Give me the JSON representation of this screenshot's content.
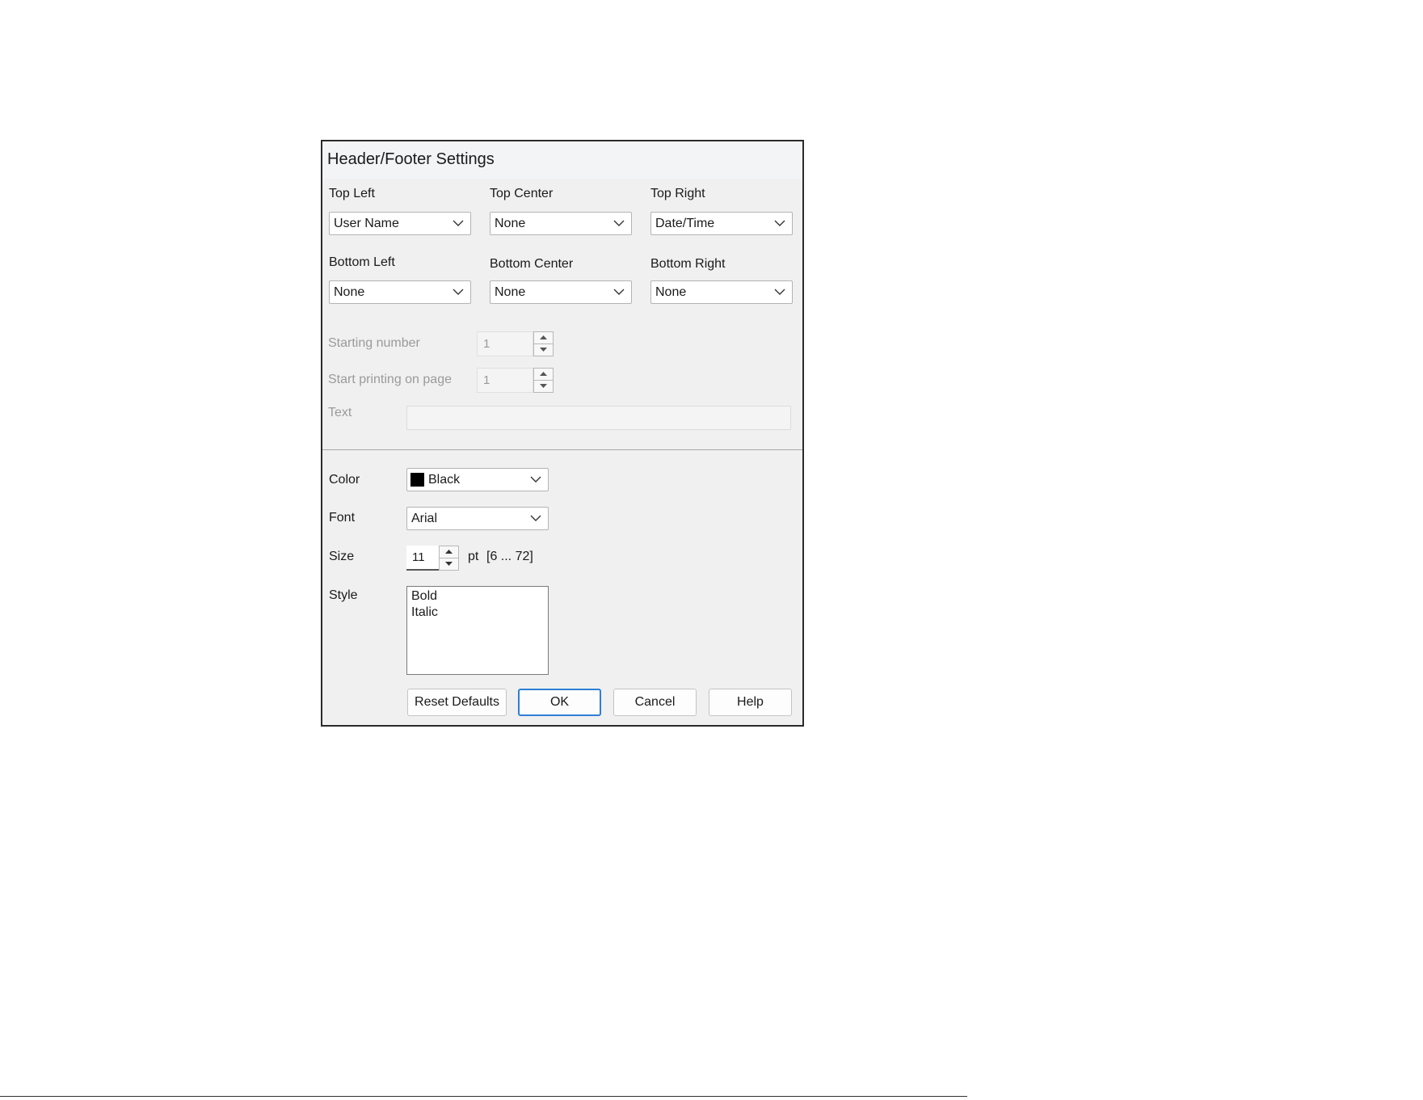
{
  "dialog": {
    "title": "Header/Footer Settings",
    "positions": {
      "top_left": {
        "label": "Top Left",
        "value": "User Name"
      },
      "top_center": {
        "label": "Top Center",
        "value": "None"
      },
      "top_right": {
        "label": "Top Right",
        "value": "Date/Time"
      },
      "bottom_left": {
        "label": "Bottom Left",
        "value": "None"
      },
      "bottom_center": {
        "label": "Bottom Center",
        "value": "None"
      },
      "bottom_right": {
        "label": "Bottom Right",
        "value": "None"
      }
    },
    "starting_number": {
      "label": "Starting number",
      "value": "1"
    },
    "start_printing": {
      "label": "Start printing on page",
      "value": "1"
    },
    "text": {
      "label": "Text",
      "value": ""
    },
    "color": {
      "label": "Color",
      "value": "Black",
      "swatch": "#000000"
    },
    "font": {
      "label": "Font",
      "value": "Arial"
    },
    "size": {
      "label": "Size",
      "value": "11",
      "unit": "pt",
      "range": "[6 ... 72]"
    },
    "style": {
      "label": "Style",
      "options": [
        "Bold",
        "Italic"
      ]
    },
    "buttons": {
      "reset": "Reset Defaults",
      "ok": "OK",
      "cancel": "Cancel",
      "help": "Help"
    }
  }
}
